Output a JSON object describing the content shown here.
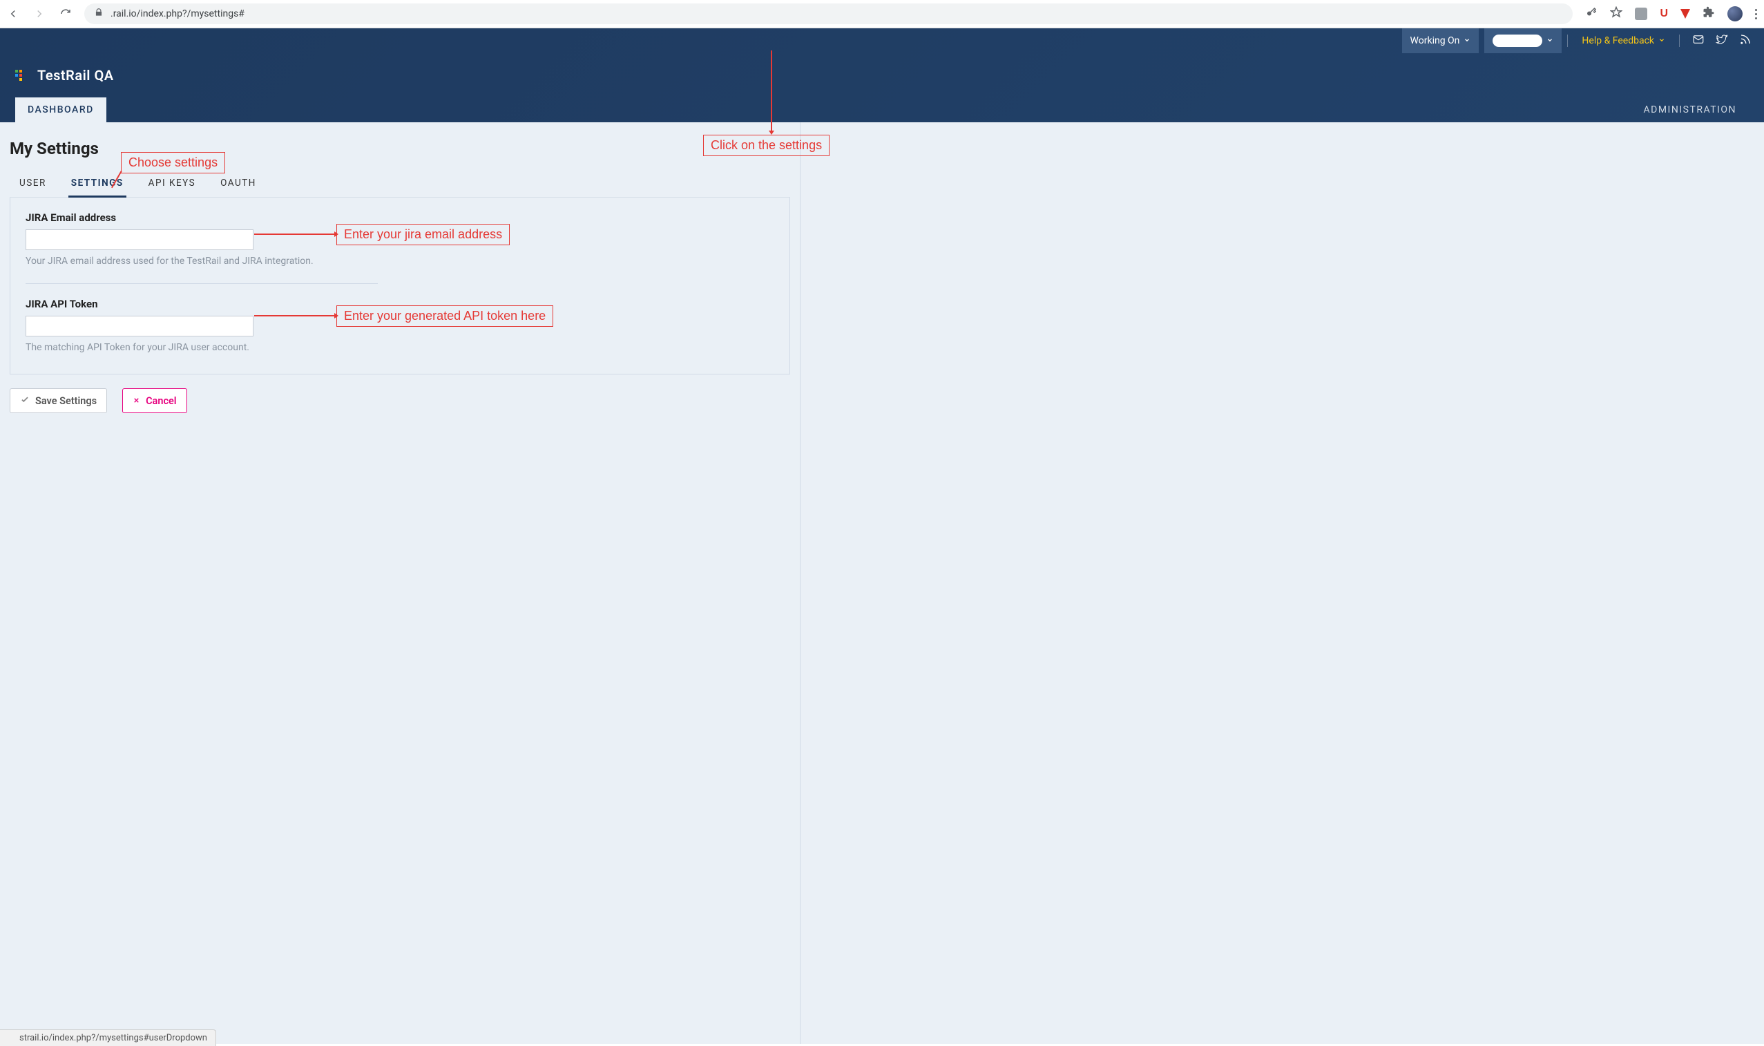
{
  "browser": {
    "url_visible": ".rail.io/index.php?/mysettings#",
    "statusbar": "strail.io/index.php?/mysettings#userDropdown",
    "ublock_letter": "U"
  },
  "top": {
    "working_on": "Working On",
    "help": "Help & Feedback"
  },
  "brand": {
    "name": "TestRail QA"
  },
  "nav": {
    "dashboard": "DASHBOARD",
    "administration": "ADMINISTRATION"
  },
  "page": {
    "title": "My Settings"
  },
  "tabs": {
    "user": "USER",
    "settings": "SETTINGS",
    "api_keys": "API KEYS",
    "oauth": "OAUTH"
  },
  "fields": {
    "jira_email": {
      "label": "JIRA Email address",
      "value": "",
      "help": "Your JIRA email address used for the TestRail and JIRA integration."
    },
    "jira_token": {
      "label": "JIRA API Token",
      "value": "",
      "help": "The matching API Token for your JIRA user account."
    }
  },
  "buttons": {
    "save": "Save Settings",
    "cancel": "Cancel"
  },
  "annotations": {
    "click_settings": "Click on the settings",
    "choose_settings": "Choose settings",
    "enter_email": "Enter your jira email address",
    "enter_token": "Enter your generated API token here"
  }
}
